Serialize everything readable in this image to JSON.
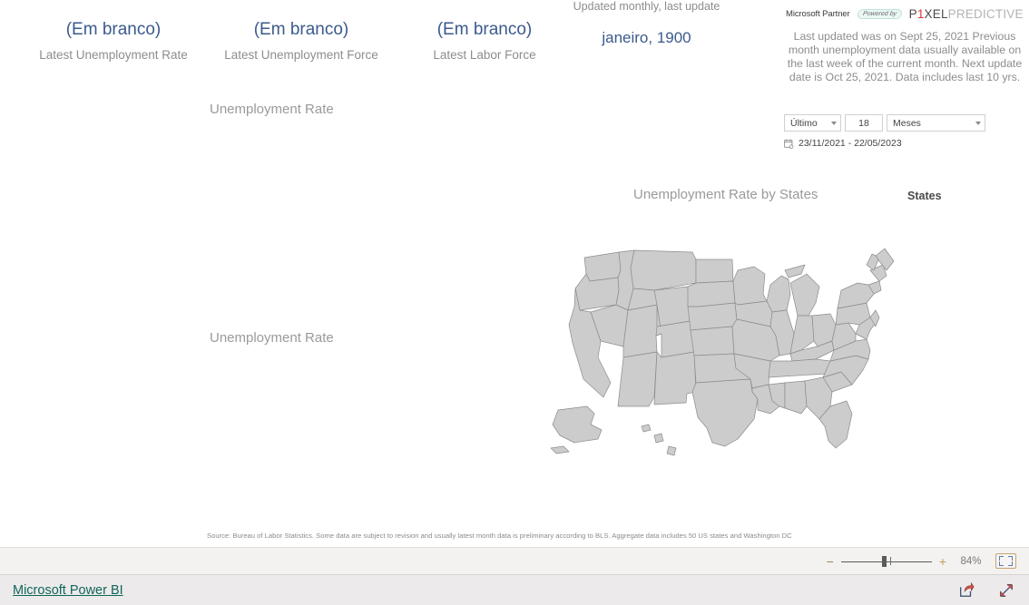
{
  "report": {
    "kpis": [
      {
        "value": "(Em branco)",
        "label": "Latest Unemployment Rate"
      },
      {
        "value": "(Em branco)",
        "label": "Latest Unemployment Force"
      },
      {
        "value": "(Em branco)",
        "label": "Latest Labor Force"
      }
    ],
    "month_card": {
      "caption": "Updated monthly, last update",
      "value": "janeiro, 1900"
    },
    "visual_titles": {
      "chart_top": "Unemployment Rate",
      "chart_bottom": "Unemployment Rate",
      "map": "Unemployment Rate by States",
      "map_legend": "States"
    },
    "branding": {
      "microsoft_partner": "Microsoft Partner",
      "powered_by": "Powered by",
      "pixel_p": "P",
      "pixel_one": "1",
      "pixel_xel": "XEL",
      "pixel_predictive": "PREDICTIVE"
    },
    "update_note": "Last updated was on Sept 25, 2021 Previous month unemployment data usually available on the last week of the current month. Next update date is Oct 25, 2021. Data includes last 10 yrs.",
    "slicer": {
      "anchor": "Último",
      "count": "18",
      "unit": "Meses",
      "range": "23/11/2021 - 22/05/2023",
      "calendar_icon": "calendar-icon"
    },
    "source_note": "Source: Bureau of Labor Statistics. Some data are subject to revision and usually latest month data is preliminary according to BLS. Aggregate data includes 50 US states and Washington DC",
    "map_colors": {
      "fill": "#cccccc",
      "stroke": "#8c8c8c"
    }
  },
  "toolbar": {
    "zoom_out_label": "−",
    "zoom_in_label": "+",
    "zoom_percent": "84%",
    "fit_to_page_icon": "fit-to-page-icon"
  },
  "footer": {
    "brand_link": "Microsoft Power BI",
    "share_icon": "share-icon",
    "fullscreen_icon": "fullscreen-icon"
  }
}
